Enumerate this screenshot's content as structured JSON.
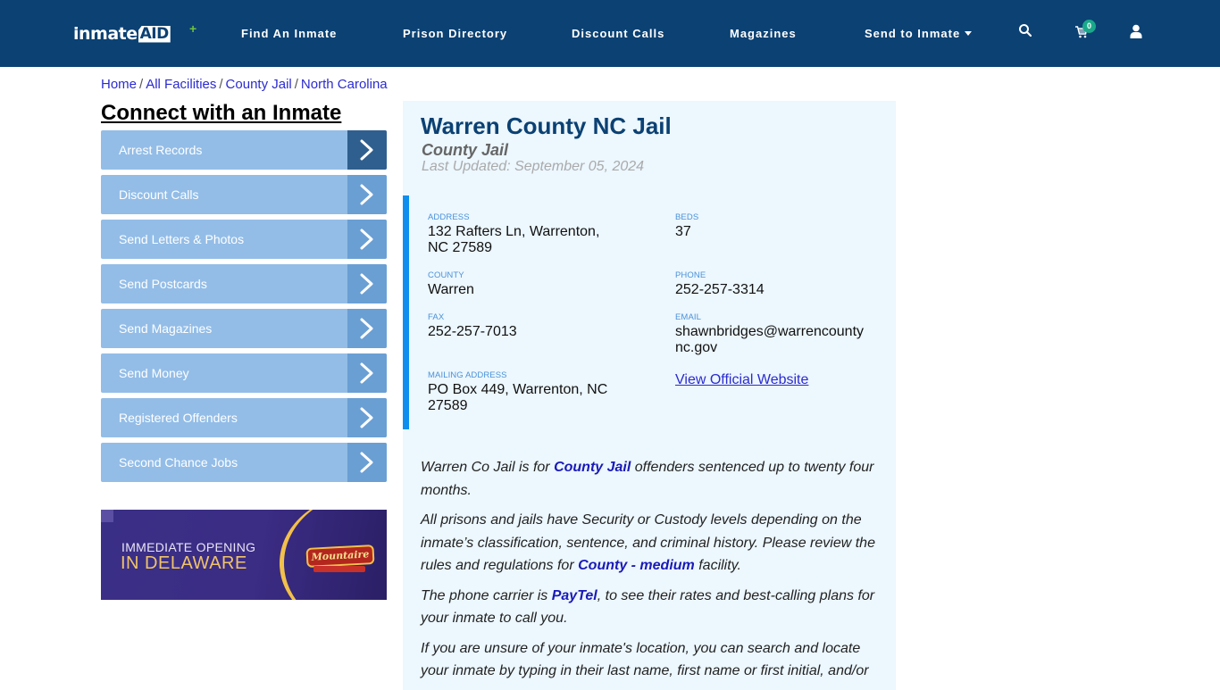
{
  "header": {
    "logo_text": "inmate",
    "logo_text_accent": "AID",
    "nav": [
      {
        "label": "Find An Inmate"
      },
      {
        "label": "Prison Directory"
      },
      {
        "label": "Discount Calls"
      },
      {
        "label": "Magazines"
      },
      {
        "label": "Send to Inmate"
      }
    ],
    "cart_count": "0",
    "icons": [
      "search-icon",
      "cart-icon",
      "user-icon"
    ]
  },
  "breadcrumb": [
    {
      "label": "Home"
    },
    {
      "label": "All Facilities"
    },
    {
      "label": "County Jail"
    },
    {
      "label": "North Carolina"
    }
  ],
  "breadcrumb_separator": "/",
  "sidebar": {
    "title": "Connect with an Inmate",
    "items": [
      {
        "label": "Arrest Records"
      },
      {
        "label": "Discount Calls"
      },
      {
        "label": "Send Letters & Photos"
      },
      {
        "label": "Send Postcards"
      },
      {
        "label": "Send Magazines"
      },
      {
        "label": "Send Money"
      },
      {
        "label": "Registered Offenders"
      },
      {
        "label": "Second Chance Jobs"
      }
    ],
    "ad": {
      "line1": "IMMEDIATE OPENING",
      "line2": "IN DELAWARE",
      "brand": "Mountaire"
    }
  },
  "facility": {
    "name": "Warren County NC Jail",
    "type": "County Jail",
    "last_updated": "Last Updated: September 05, 2024",
    "fields": {
      "address": {
        "label": "ADDRESS",
        "line1": "132 Rafters Ln, Warrenton,",
        "line2": "NC 27589"
      },
      "beds": {
        "label": "BEDS",
        "value": "37"
      },
      "county": {
        "label": "COUNTY",
        "value": "Warren"
      },
      "phone": {
        "label": "PHONE",
        "value": "252-257-3314"
      },
      "fax": {
        "label": "FAX",
        "value": "252-257-7013"
      },
      "email": {
        "label": "EMAIL",
        "line1": "shawnbridges@warrencounty",
        "line2": "nc.gov"
      },
      "mailing": {
        "label": "MAILING ADDRESS",
        "line1": "PO Box 449, Warrenton, NC",
        "line2": "27589"
      },
      "website_link": "View Official Website"
    },
    "description": {
      "p1_a": "Warren Co Jail is for ",
      "p1_link": "County Jail",
      "p1_b": " offenders sentenced up to twenty four months.",
      "p2_a": "All prisons and jails have Security or Custody levels depending on the inmate’s classification, sentence, and criminal history. Please review the rules and regulations for ",
      "p2_link": "County - medium",
      "p2_b": " facility.",
      "p3_a": "The phone carrier is ",
      "p3_link": "PayTel",
      "p3_b": ", to see their rates and best-calling plans for your inmate to call you.",
      "p4": "If you are unsure of your inmate's location, you can search and locate your inmate by typing in their last name, first name or first initial, and/or"
    }
  },
  "colors": {
    "navbar": "#0b4173",
    "menu_item": "#93bde7",
    "menu_arrow": "#6a9fd4",
    "menu_arrow_active": "#2f5f8f",
    "panel_bg": "#ecf7fe",
    "accent_bar": "#0e8ff0",
    "badge": "#19a98a"
  }
}
